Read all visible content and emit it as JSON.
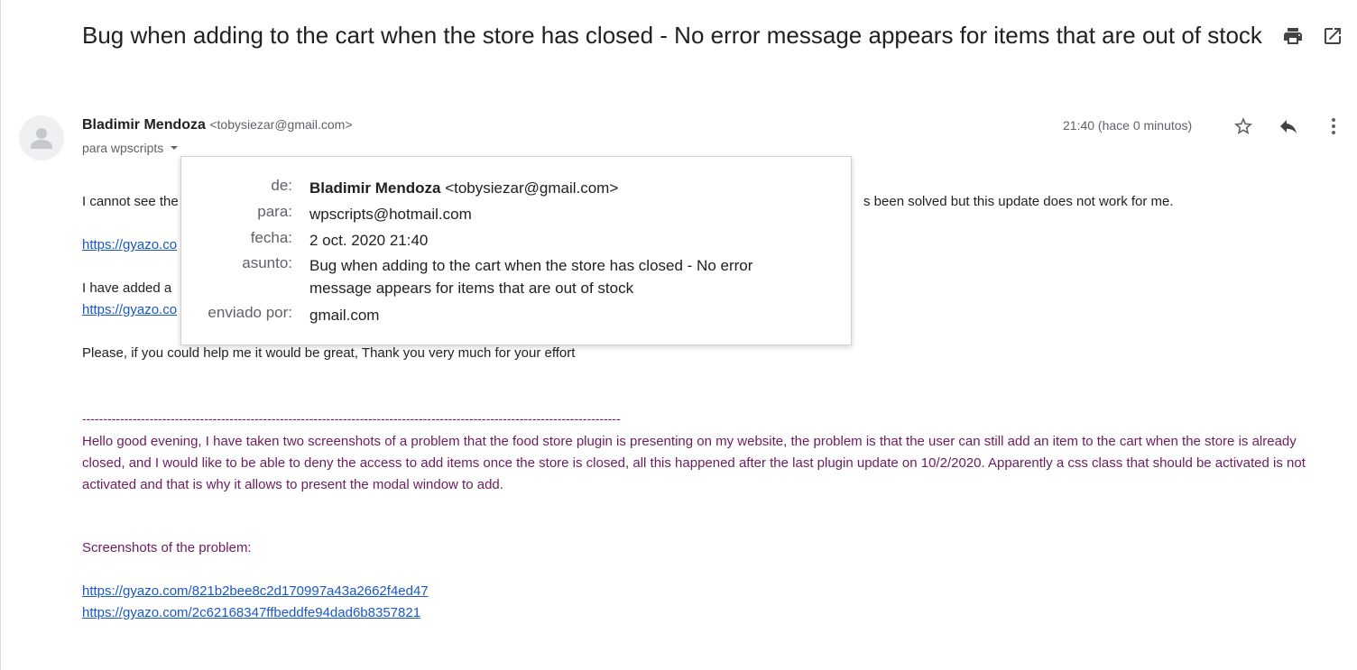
{
  "email": {
    "subject": "Bug when adding to the cart when the store has closed - No error message appears for items that are out of stock",
    "sender_name": "Bladimir Mendoza",
    "sender_email": "<tobysiezar@gmail.com>",
    "recipient_summary": "para wpscripts",
    "timestamp": "21:40 (hace 0 minutos)"
  },
  "body": {
    "line1_start": "I cannot see the",
    "line1_end": "s been solved but this update does not work for me.",
    "link1_partial": "https://gyazo.co",
    "line3_start": "I have added a",
    "link2_partial": "https://gyazo.co",
    "line5": "Please, if you could help me it would be great, Thank you very much for your effort",
    "divider": "--------------------------------------------------------------------------------------------------------------------------------",
    "quoted_paragraph": "Hello good evening, I have taken two screenshots of a problem that the food store plugin is presenting on my website, the problem is that the user can still add an item to the cart when the store is already closed, and I would like to be able to deny the access to add items once the store is closed, all this happened after the last plugin update on 10/2/2020. Apparently a css class that should be activated is not activated and that is why it allows to present the modal window to add.",
    "screenshots_label": "Screenshots of the problem:",
    "link3": "https://gyazo.com/821b2bee8c2d170997a43a2662f4ed47",
    "link4": "https://gyazo.com/2c62168347ffbeddfe94dad6b8357821"
  },
  "details_popup": {
    "from_label": "de:",
    "from_name": "Bladimir Mendoza",
    "from_email": "<tobysiezar@gmail.com>",
    "to_label": "para:",
    "to_value": "wpscripts@hotmail.com",
    "date_label": "fecha:",
    "date_value": "2 oct. 2020 21:40",
    "subject_label": "asunto:",
    "subject_value": "Bug when adding to the cart when the store has closed - No error message appears for items that are out of stock",
    "sent_by_label": "enviado por:",
    "sent_by_value": "gmail.com"
  },
  "icons": {
    "print": "print-icon",
    "open_new_window": "open-in-new-window-icon",
    "star": "star-icon",
    "reply": "reply-icon",
    "more": "more-vertical-icon",
    "avatar": "default-avatar-icon",
    "dropdown": "caret-down-icon"
  }
}
